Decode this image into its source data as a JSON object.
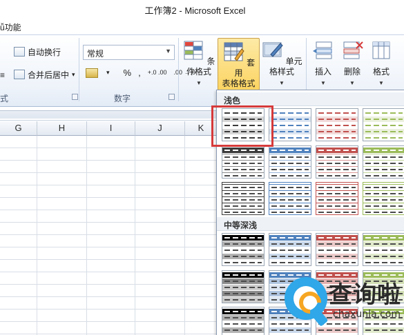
{
  "window": {
    "title": "工作簿2 - Microsoft Excel"
  },
  "menu": {
    "addin_label": "ǚ功能"
  },
  "ribbon": {
    "alignment": {
      "wrap_text": "自动换行",
      "merge_center": "合并后居中",
      "merge_dropdown": "▾",
      "group_label": "式",
      "left_icon": "≡"
    },
    "number": {
      "format_value": "常规",
      "currency_symbol": "▾",
      "percent": "%",
      "comma": ",",
      "inc_decimal": "+.0 .00",
      "dec_decimal": ".00 →.0",
      "group_label": "数字"
    },
    "styles": {
      "conditional_format": "条件格式",
      "format_as_table_line1": "套用",
      "format_as_table_line2": "表格格式",
      "cell_styles": "单元格样式"
    },
    "cells": {
      "insert": "插入",
      "delete": "删除",
      "format": "格式"
    }
  },
  "sheet": {
    "columns": [
      "G",
      "H",
      "I",
      "J",
      "K"
    ]
  },
  "gallery": {
    "section_light": "浅色",
    "section_medium": "中等深浅",
    "light_styles": [
      {
        "name": "table-style-light-1",
        "accent": "#3a3a3a"
      },
      {
        "name": "table-style-light-2",
        "accent": "#4f81bd"
      },
      {
        "name": "table-style-light-3",
        "accent": "#c0504d"
      },
      {
        "name": "table-style-light-4",
        "accent": "#9bbb59"
      }
    ],
    "medium_styles_accents": [
      "#000000",
      "#4f81bd",
      "#c0504d",
      "#9bbb59"
    ]
  },
  "watermark": {
    "brand": "查询啦",
    "domain": "chaxunla.com"
  }
}
